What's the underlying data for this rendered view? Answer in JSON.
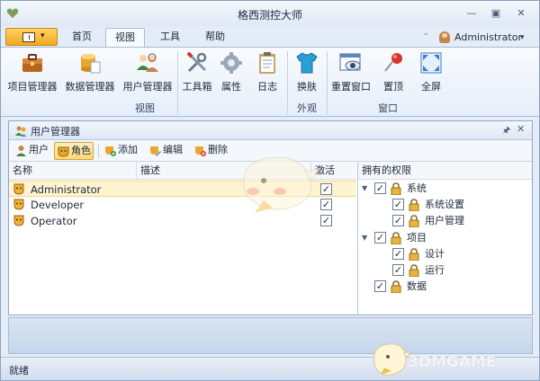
{
  "window": {
    "title": "格西测控大师"
  },
  "tabs": [
    {
      "label": "首页",
      "active": false
    },
    {
      "label": "视图",
      "active": true
    },
    {
      "label": "工具",
      "active": false
    },
    {
      "label": "帮助",
      "active": false
    }
  ],
  "user": {
    "name": "Administrator"
  },
  "ribbon": {
    "buttons": [
      {
        "label": "项目管理器",
        "icon": "briefcase-icon"
      },
      {
        "label": "数据管理器",
        "icon": "database-icon"
      },
      {
        "label": "用户管理器",
        "icon": "users-icon"
      },
      {
        "label": "工具箱",
        "icon": "tools-icon"
      },
      {
        "label": "属性",
        "icon": "gear-icon"
      },
      {
        "label": "日志",
        "icon": "clipboard-icon"
      },
      {
        "label": "换肤",
        "icon": "shirt-icon"
      },
      {
        "label": "重置窗口",
        "icon": "window-eye-icon"
      },
      {
        "label": "置顶",
        "icon": "pushpin-icon"
      },
      {
        "label": "全屏",
        "icon": "fullscreen-icon"
      }
    ],
    "groups": [
      "视图",
      "外观",
      "窗口"
    ]
  },
  "panel": {
    "title": "用户管理器",
    "toolbar": [
      {
        "label": "用户",
        "icon": "user-icon",
        "selected": false
      },
      {
        "label": "角色",
        "icon": "role-mask-icon",
        "selected": true
      },
      {
        "label": "添加",
        "icon": "add-icon",
        "selected": false
      },
      {
        "label": "编辑",
        "icon": "edit-icon",
        "selected": false
      },
      {
        "label": "删除",
        "icon": "delete-icon",
        "selected": false
      }
    ],
    "columns": [
      "名称",
      "描述",
      "激活"
    ],
    "roles": [
      {
        "name": "Administrator",
        "description": "",
        "active": true,
        "selected": true
      },
      {
        "name": "Developer",
        "description": "",
        "active": true,
        "selected": false
      },
      {
        "name": "Operator",
        "description": "",
        "active": true,
        "selected": false
      }
    ],
    "permissions_header": "拥有的权限",
    "permissions": [
      {
        "label": "系统",
        "level": 0,
        "expanded": true,
        "checked": true
      },
      {
        "label": "系统设置",
        "level": 1,
        "checked": true
      },
      {
        "label": "用户管理",
        "level": 1,
        "checked": true
      },
      {
        "label": "项目",
        "level": 0,
        "expanded": true,
        "checked": true
      },
      {
        "label": "设计",
        "level": 1,
        "checked": true
      },
      {
        "label": "运行",
        "level": 1,
        "checked": true
      },
      {
        "label": "数据",
        "level": 0,
        "checked": true
      }
    ]
  },
  "status": {
    "text": "就绪"
  },
  "watermark": "3DMGAME",
  "colors": {
    "accent": "#f2a71d",
    "selection": "#fff4d0",
    "chrome": "#dfe8f4"
  }
}
